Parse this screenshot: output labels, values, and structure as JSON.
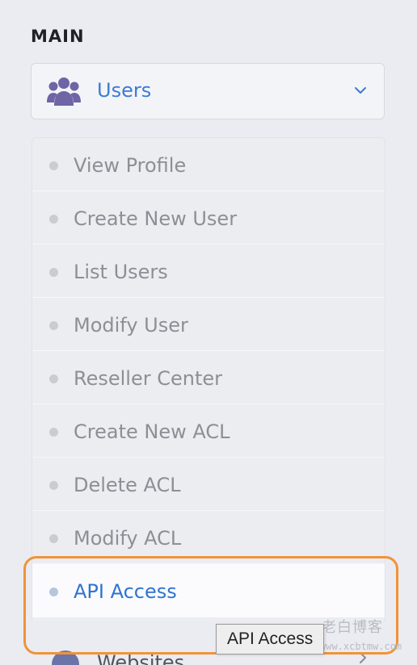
{
  "section": {
    "title": "MAIN"
  },
  "menu": {
    "header": {
      "label": "Users",
      "icon": "users-icon",
      "accent": "#3b7bd4"
    },
    "items": [
      {
        "label": "View Profile"
      },
      {
        "label": "Create New User"
      },
      {
        "label": "List Users"
      },
      {
        "label": "Modify User"
      },
      {
        "label": "Reseller Center"
      },
      {
        "label": "Create New ACL"
      },
      {
        "label": "Delete ACL"
      },
      {
        "label": "Modify ACL"
      },
      {
        "label": "API Access",
        "active": true
      }
    ],
    "next": {
      "label": "Websites",
      "icon": "globe-icon"
    }
  },
  "tooltip": {
    "text": "API Access"
  },
  "watermark": {
    "text": "老白博客",
    "url": "www.xcbtmw.com"
  },
  "colors": {
    "highlight_outline": "#f0933a",
    "active_text": "#2f73d0",
    "inactive_text": "#8c8f96"
  }
}
